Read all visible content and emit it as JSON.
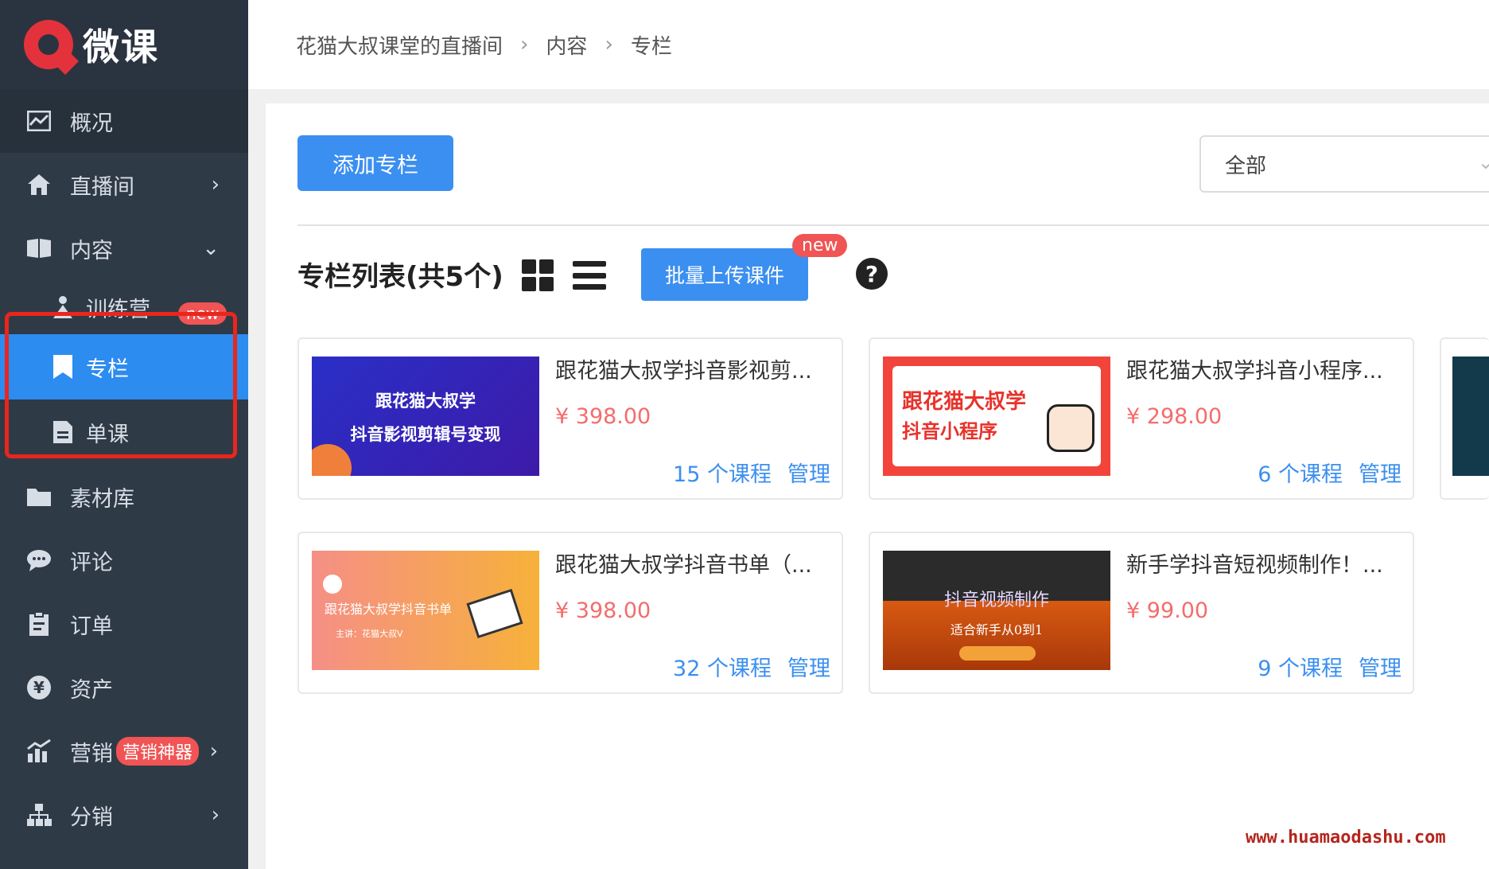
{
  "brand": {
    "name": "微课"
  },
  "sidebar": {
    "items": [
      {
        "label": "概况"
      },
      {
        "label": "直播间"
      },
      {
        "label": "内容"
      },
      {
        "label": "训练营",
        "badge": "new"
      },
      {
        "label": "专栏"
      },
      {
        "label": "单课"
      },
      {
        "label": "素材库"
      },
      {
        "label": "评论"
      },
      {
        "label": "订单"
      },
      {
        "label": "资产"
      },
      {
        "label": "营销",
        "badge": "营销神器"
      },
      {
        "label": "分销"
      }
    ]
  },
  "breadcrumb": [
    "花猫大叔课堂的直播间",
    "内容",
    "专栏"
  ],
  "toolbar": {
    "add_label": "添加专栏",
    "filter_value": "全部"
  },
  "list": {
    "title": "专栏列表(共5个)",
    "batch_label": "批量上传课件",
    "batch_badge": "new",
    "help": "?"
  },
  "cards": [
    {
      "title": "跟花猫大叔学抖音影视剪...",
      "price": "¥ 398.00",
      "count": "15 个课程",
      "manage": "管理",
      "thumb_lines": [
        "跟花猫大叔学",
        "抖音影视剪辑号变现"
      ]
    },
    {
      "title": "跟花猫大叔学抖音小程序...",
      "price": "¥ 298.00",
      "count": "6 个课程",
      "manage": "管理",
      "thumb_lines": [
        "跟花猫大叔学",
        "抖音小程序"
      ]
    },
    {
      "title": "跟花猫大叔学抖音书单（...",
      "price": "¥ 398.00",
      "count": "32 个课程",
      "manage": "管理",
      "thumb_lines": [
        "跟花猫大叔学抖音书单",
        "主讲：花猫大叔V"
      ]
    },
    {
      "title": "新手学抖音短视频制作！...",
      "price": "¥ 99.00",
      "count": "9 个课程",
      "manage": "管理",
      "thumb_lines": [
        "抖音视频制作",
        "适合新手从0到1"
      ]
    }
  ],
  "watermark": "www.huamaodashu.com",
  "colors": {
    "sidebar_bg": "#2f3a47",
    "accent": "#3b8ff0",
    "price": "#f56c6c",
    "badge": "#f05454"
  }
}
